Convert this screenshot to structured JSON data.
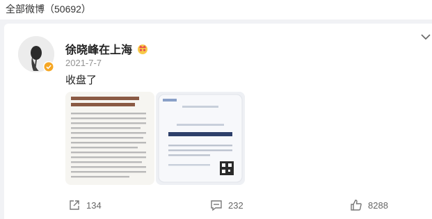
{
  "header": {
    "title": "全部微博（50692）"
  },
  "post": {
    "username": "徐晓峰在上海",
    "time": "2021-7-7",
    "text": "收盘了"
  },
  "actions": {
    "repost_count": "134",
    "comment_count": "232",
    "like_count": "8288"
  },
  "colors": {
    "background": "#f1f2f5",
    "verify_badge": "#f5a623",
    "text_primary": "#222222",
    "text_secondary": "#939393"
  },
  "icons": [
    "chevron-down-icon",
    "verified-badge-icon",
    "crown-icon",
    "repost-icon",
    "comment-icon",
    "like-icon"
  ]
}
